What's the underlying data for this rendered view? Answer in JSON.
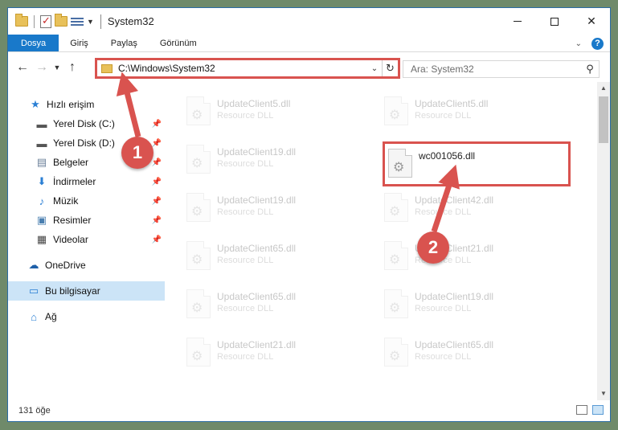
{
  "window": {
    "title": "System32"
  },
  "ribbon": {
    "tabs": [
      {
        "label": "Dosya",
        "active": true
      },
      {
        "label": "Giriş"
      },
      {
        "label": "Paylaş"
      },
      {
        "label": "Görünüm"
      }
    ]
  },
  "nav": {
    "address": "C:\\Windows\\System32",
    "search_placeholder": "Ara: System32"
  },
  "sidebar": {
    "items": [
      {
        "label": "Hızlı erişim",
        "icon": "star-icon"
      },
      {
        "label": "Yerel Disk (C:)",
        "icon": "drive-icon",
        "pinned": true
      },
      {
        "label": "Yerel Disk (D:)",
        "icon": "drive-icon",
        "pinned": true
      },
      {
        "label": "Belgeler",
        "icon": "documents-icon",
        "pinned": true
      },
      {
        "label": "İndirmeler",
        "icon": "download-icon",
        "pinned": true
      },
      {
        "label": "Müzik",
        "icon": "music-icon",
        "pinned": true
      },
      {
        "label": "Resimler",
        "icon": "pictures-icon",
        "pinned": true
      },
      {
        "label": "Videolar",
        "icon": "video-icon",
        "pinned": true
      },
      {
        "label": "OneDrive",
        "icon": "cloud-icon"
      },
      {
        "label": "Bu bilgisayar",
        "icon": "computer-icon",
        "selected": true
      },
      {
        "label": "Ağ",
        "icon": "network-icon"
      }
    ]
  },
  "files": {
    "left": [
      {
        "name": "UpdateClient5.dll",
        "type": "Resource DLL"
      },
      {
        "name": "UpdateClient19.dll",
        "type": "Resource DLL"
      },
      {
        "name": "UpdateClient19.dll",
        "type": "Resource DLL"
      },
      {
        "name": "UpdateClient65.dll",
        "type": "Resource DLL"
      },
      {
        "name": "UpdateClient65.dll",
        "type": "Resource DLL"
      },
      {
        "name": "UpdateClient21.dll",
        "type": "Resource DLL"
      }
    ],
    "right": [
      {
        "name": "UpdateClient5.dll",
        "type": "Resource DLL"
      },
      {
        "name": "wc001056.dll",
        "type": "",
        "highlighted": true
      },
      {
        "name": "UpdateClient42.dll",
        "type": "Resource DLL"
      },
      {
        "name": "UpdateClient21.dll",
        "type": "Resource DLL"
      },
      {
        "name": "UpdateClient19.dll",
        "type": "Resource DLL"
      },
      {
        "name": "UpdateClient65.dll",
        "type": "Resource DLL"
      }
    ]
  },
  "status": {
    "count": "131 öğe"
  },
  "annotations": {
    "step1": "1",
    "step2": "2"
  },
  "colors": {
    "accent": "#1979ca",
    "annotation": "#d9534f",
    "selected_bg": "#cce4f7"
  }
}
